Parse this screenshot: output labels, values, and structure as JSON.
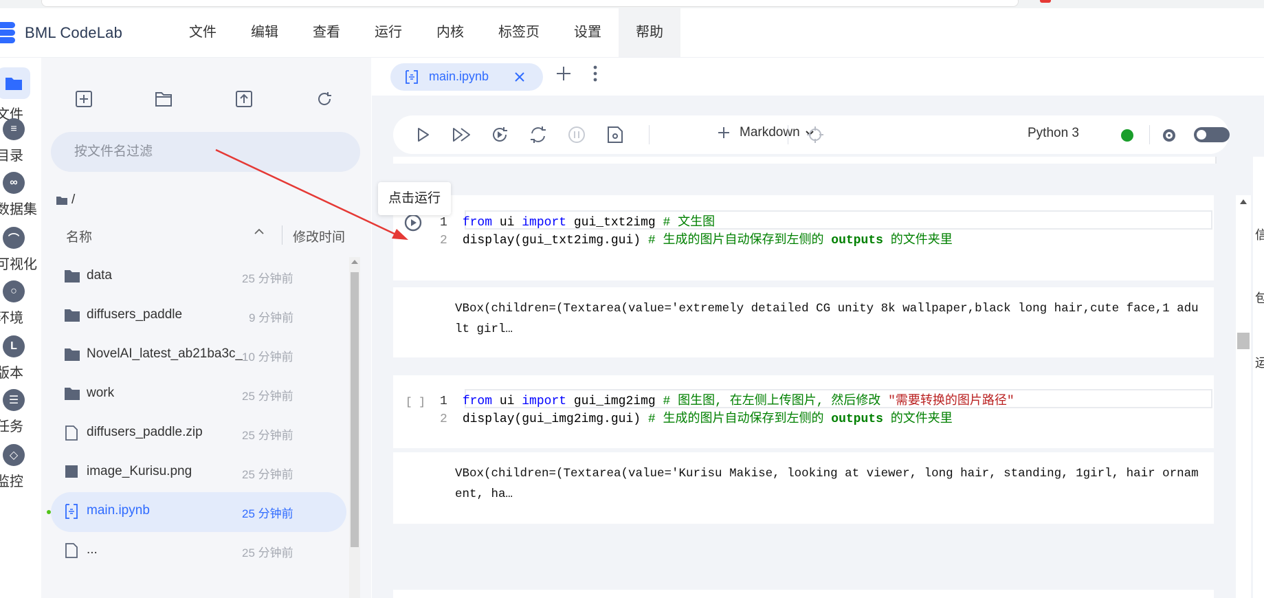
{
  "app": {
    "name": "BML CodeLab"
  },
  "menu": [
    "文件",
    "编辑",
    "查看",
    "运行",
    "内核",
    "标签页",
    "设置",
    "帮助"
  ],
  "activity": [
    {
      "label": "文件",
      "icon": "folder-icon"
    },
    {
      "label": "目录",
      "icon": "list-icon"
    },
    {
      "label": "数据集",
      "icon": "dataset-icon"
    },
    {
      "label": "可视化",
      "icon": "chart-icon"
    },
    {
      "label": "环境",
      "icon": "environment-icon"
    },
    {
      "label": "版本",
      "icon": "version-icon"
    },
    {
      "label": "任务",
      "icon": "task-icon"
    },
    {
      "label": "监控",
      "icon": "monitor-icon"
    }
  ],
  "sidebar": {
    "filter_placeholder": "按文件名过滤",
    "path": "/",
    "col_name": "名称",
    "col_time": "修改时间",
    "files": [
      {
        "name": "data",
        "time": "25 分钟前",
        "type": "folder"
      },
      {
        "name": "diffusers_paddle",
        "time": "9 分钟前",
        "type": "folder"
      },
      {
        "name": "NovelAI_latest_ab21ba3c_",
        "time": "10 分钟前",
        "type": "folder"
      },
      {
        "name": "work",
        "time": "25 分钟前",
        "type": "folder"
      },
      {
        "name": "diffusers_paddle.zip",
        "time": "25 分钟前",
        "type": "file"
      },
      {
        "name": "image_Kurisu.png",
        "time": "25 分钟前",
        "type": "image"
      },
      {
        "name": "main.ipynb",
        "time": "25 分钟前",
        "type": "notebook"
      },
      {
        "name": "...",
        "time": "25 分钟前",
        "type": "file"
      }
    ]
  },
  "tab": {
    "label": "main.ipynb"
  },
  "toolbar": {
    "cell_type": "Markdown",
    "kernel": "Python 3",
    "kernel_status_color": "#1a9e2b"
  },
  "tooltip": "点击运行",
  "cells": [
    {
      "prompt": "",
      "line1": {
        "n": "1",
        "from": "from",
        "mod": " ui ",
        "imp": "import",
        "name": " gui_txt2img ",
        "comment": "# 文生图"
      },
      "line2": {
        "n": "2",
        "code": "display(gui_txt2img.gui) ",
        "c1": "# 生成的图片自动保存到左侧的 ",
        "c2": "outputs",
        "c3": " 的文件夹里"
      },
      "output": [
        "VBox(children=(Textarea(value='extremely detailed CG unity 8k wallpaper,black long hair,cute face,1 adu",
        "lt girl…"
      ]
    },
    {
      "prompt": "[ ]",
      "line1": {
        "n": "1",
        "from": "from",
        "mod": " ui ",
        "imp": "import",
        "name": " gui_img2img ",
        "comment": "# 图生图, 在左侧上传图片, 然后修改 ",
        "str": "\"需要转换的图片路径\""
      },
      "line2": {
        "n": "2",
        "code": "display(gui_img2img.gui) ",
        "c1": "# 生成的图片自动保存到左侧的 ",
        "c2": "outputs",
        "c3": " 的文件夹里"
      },
      "output": [
        "VBox(children=(Textarea(value='Kurisu Makise, looking at viewer, long hair, standing, 1girl, hair ornam",
        "ent, ha…"
      ]
    }
  ],
  "right_panel": [
    "信",
    "包",
    "运"
  ],
  "colors": {
    "accent": "#2f6bff",
    "annotation_arrow": "#e53935"
  }
}
